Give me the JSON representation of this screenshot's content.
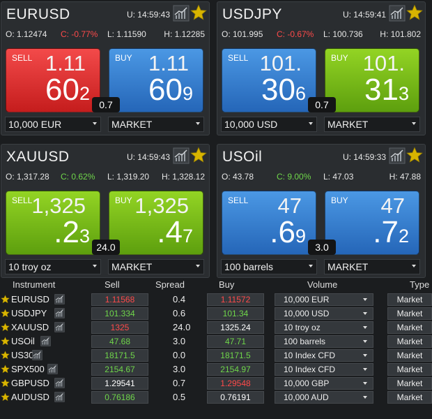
{
  "panels": [
    {
      "symbol": "EURUSD",
      "time": "U: 14:59:43",
      "open": "O: 1.12474",
      "change": "C: -0.77%",
      "change_dir": "down",
      "low": "L: 1.11590",
      "high": "H: 1.12285",
      "sell": {
        "label": "SELL",
        "big": "1.11",
        "main": "60",
        "sup": "2",
        "color": "red"
      },
      "buy": {
        "label": "BUY",
        "big": "1.11",
        "main": "60",
        "sup": "9",
        "color": "blue"
      },
      "spread": "0.7",
      "volume": "10,000 EUR",
      "order_type": "MARKET"
    },
    {
      "symbol": "USDJPY",
      "time": "U: 14:59:41",
      "open": "O: 101.995",
      "change": "C: -0.67%",
      "change_dir": "down",
      "low": "L: 100.736",
      "high": "H: 101.802",
      "sell": {
        "label": "SELL",
        "big": "101.",
        "main": "30",
        "sup": "6",
        "color": "blue"
      },
      "buy": {
        "label": "BUY",
        "big": "101.",
        "main": "31",
        "sup": "3",
        "color": "green"
      },
      "spread": "0.7",
      "volume": "10,000 USD",
      "order_type": "MARKET"
    },
    {
      "symbol": "XAUUSD",
      "time": "U: 14:59:43",
      "open": "O: 1,317.28",
      "change": "C: 0.62%",
      "change_dir": "up",
      "low": "L: 1,319.20",
      "high": "H: 1,328.12",
      "sell": {
        "label": "SELL",
        "big": "1,325",
        "main": ".2",
        "sup": "3",
        "color": "green"
      },
      "buy": {
        "label": "BUY",
        "big": "1,325",
        "main": ".4",
        "sup": "7",
        "color": "green"
      },
      "spread": "24.0",
      "volume": "10 troy oz",
      "order_type": "MARKET"
    },
    {
      "symbol": "USOil",
      "time": "U: 14:59:33",
      "open": "O: 43.78",
      "change": "C: 9.00%",
      "change_dir": "up",
      "low": "L: 47.03",
      "high": "H: 47.88",
      "sell": {
        "label": "SELL",
        "big": "47",
        "main": ".6",
        "sup": "9",
        "color": "blue"
      },
      "buy": {
        "label": "BUY",
        "big": "47",
        "main": ".7",
        "sup": "2",
        "color": "blue"
      },
      "spread": "3.0",
      "volume": "100 barrels",
      "order_type": "MARKET"
    }
  ],
  "table": {
    "headers": {
      "instrument": "Instrument",
      "sell": "Sell",
      "spread": "Spread",
      "buy": "Buy",
      "volume": "Volume",
      "type": "Type"
    },
    "rows": [
      {
        "name": "EURUSD",
        "sell": "1.11568",
        "sell_color": "red",
        "spread": "0.4",
        "buy": "1.11572",
        "buy_color": "red",
        "volume": "10,000 EUR",
        "type": "Market"
      },
      {
        "name": "USDJPY",
        "sell": "101.334",
        "sell_color": "green",
        "spread": "0.6",
        "buy": "101.34",
        "buy_color": "green",
        "volume": "10,000 USD",
        "type": "Market"
      },
      {
        "name": "XAUUSD",
        "sell": "1325",
        "sell_color": "red",
        "spread": "24.0",
        "buy": "1325.24",
        "buy_color": "white",
        "volume": "10 troy oz",
        "type": "Market"
      },
      {
        "name": "USOil",
        "sell": "47.68",
        "sell_color": "green",
        "spread": "3.0",
        "buy": "47.71",
        "buy_color": "green",
        "volume": "100 barrels",
        "type": "Market"
      },
      {
        "name": "US30",
        "sell": "18171.5",
        "sell_color": "green",
        "spread": "0.0",
        "buy": "18171.5",
        "buy_color": "green",
        "volume": "10 Index CFD",
        "type": "Market"
      },
      {
        "name": "SPX500",
        "sell": "2154.67",
        "sell_color": "green",
        "spread": "3.0",
        "buy": "2154.97",
        "buy_color": "green",
        "volume": "10 Index CFD",
        "type": "Market"
      },
      {
        "name": "GBPUSD",
        "sell": "1.29541",
        "sell_color": "white",
        "spread": "0.7",
        "buy": "1.29548",
        "buy_color": "red",
        "volume": "10,000 GBP",
        "type": "Market"
      },
      {
        "name": "AUDUSD",
        "sell": "0.76186",
        "sell_color": "green",
        "spread": "0.5",
        "buy": "0.76191",
        "buy_color": "white",
        "volume": "10,000 AUD",
        "type": "Market"
      }
    ]
  },
  "colors": {
    "star": "#d8b400",
    "red": "#ff4a4a",
    "green": "#6fd64a"
  }
}
